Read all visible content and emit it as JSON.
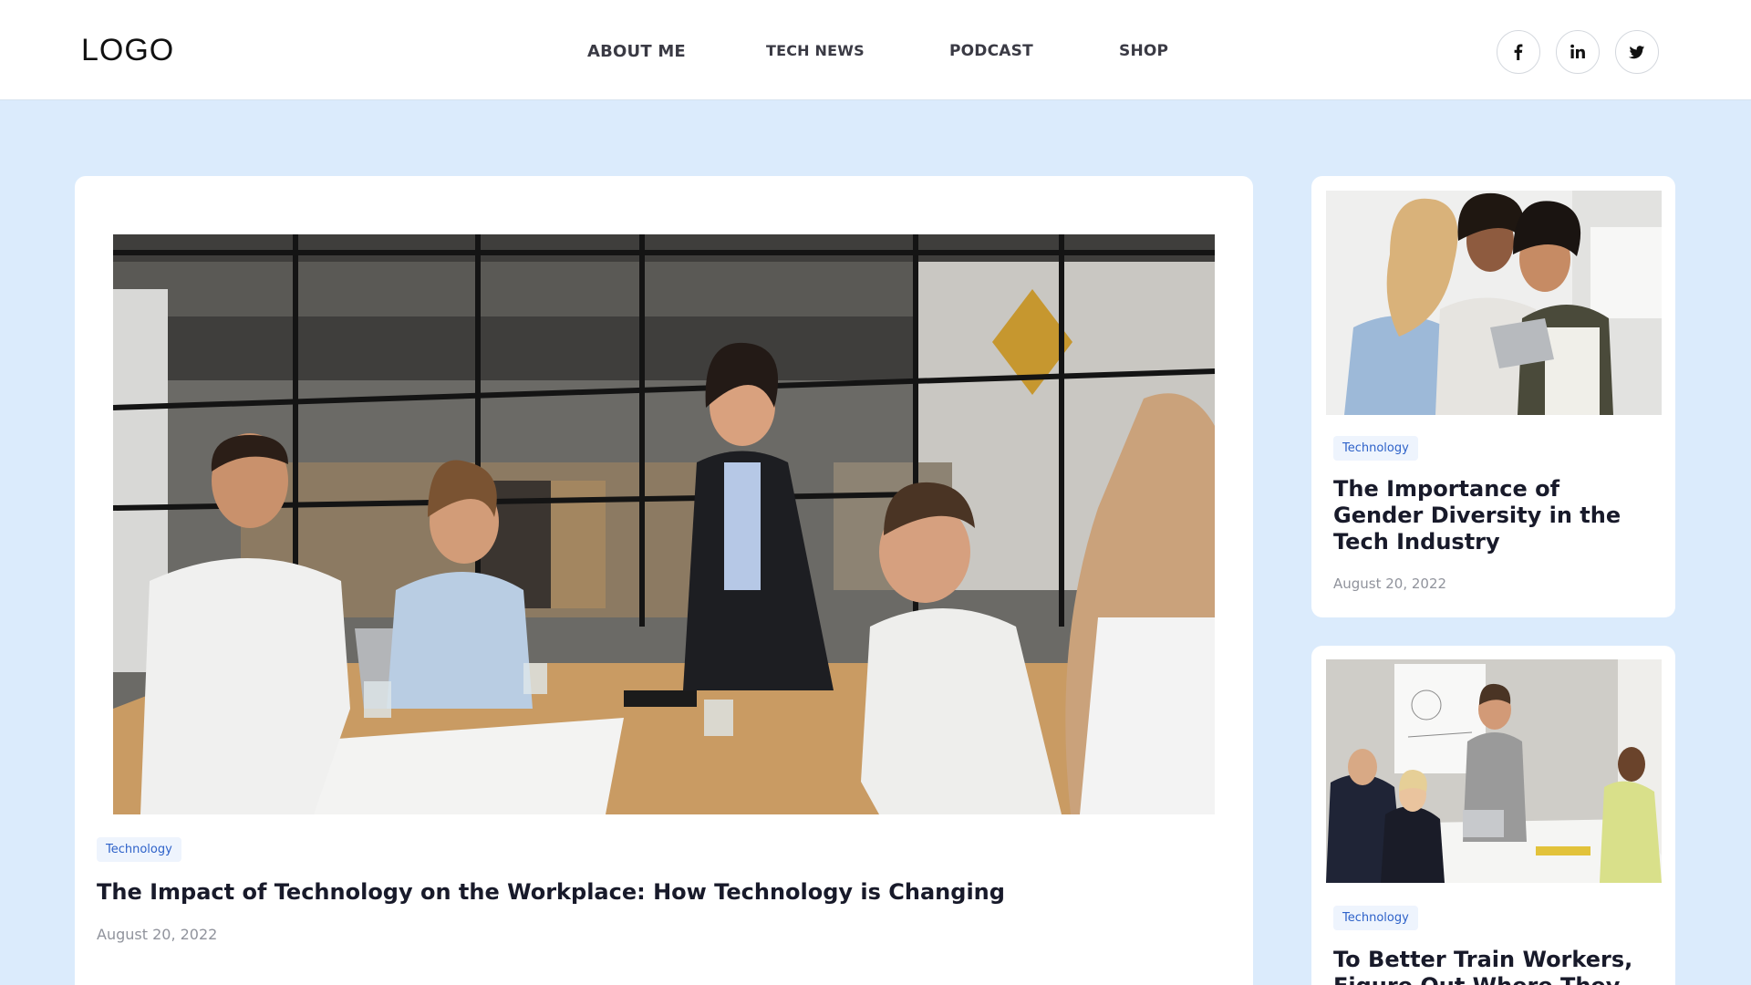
{
  "header": {
    "logo": "LOGO",
    "nav": [
      {
        "label": "ABOUT ME"
      },
      {
        "label": "TECH NEWS"
      },
      {
        "label": "PODCAST"
      },
      {
        "label": "SHOP"
      }
    ],
    "social_icons": [
      "facebook-icon",
      "linkedin-icon",
      "twitter-icon"
    ]
  },
  "featured": {
    "tag": "Technology",
    "title": "The Impact of Technology on the Workplace: How Technology is Changing",
    "date": "August 20, 2022"
  },
  "sidebar": [
    {
      "tag": "Technology",
      "title": "The Importance of Gender Diversity in the Tech Industry",
      "date": "August 20, 2022"
    },
    {
      "tag": "Technology",
      "title": "To Better Train Workers, Figure Out Where They"
    }
  ],
  "colors": {
    "page_background": "#dbebfc",
    "tag_text": "#2e62c9",
    "tag_background": "#eef4fd"
  }
}
